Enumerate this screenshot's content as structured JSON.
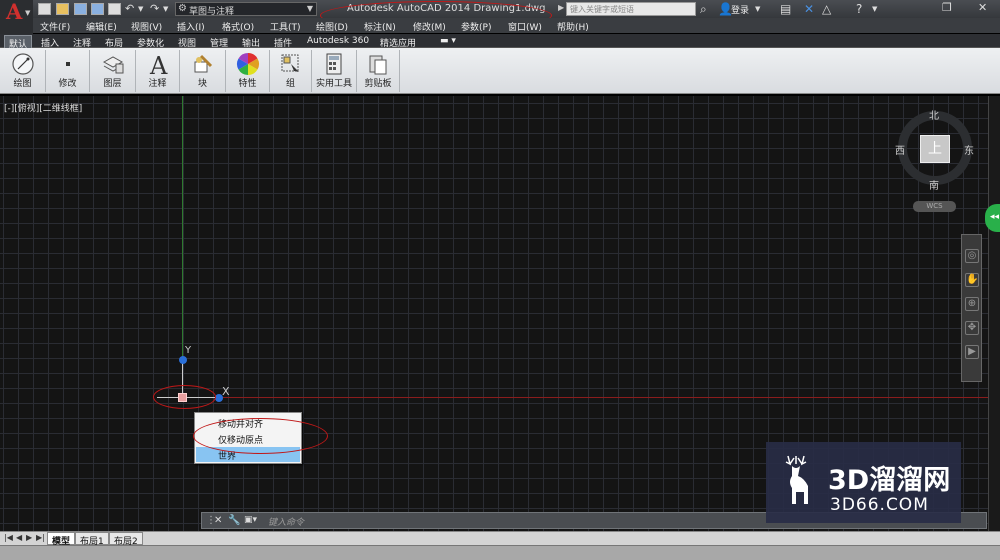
{
  "titlebar": {
    "app_logo": "A",
    "workspace": "草图与注释",
    "title": "Autodesk AutoCAD 2014    Drawing1.dwg",
    "search_placeholder": "键入关键字或短语",
    "login": "登录"
  },
  "menubar": [
    "文件(F)",
    "编辑(E)",
    "视图(V)",
    "插入(I)",
    "格式(O)",
    "工具(T)",
    "绘图(D)",
    "标注(N)",
    "修改(M)",
    "参数(P)",
    "窗口(W)",
    "帮助(H)"
  ],
  "ribbon_tabs": [
    "默认",
    "插入",
    "注释",
    "布局",
    "参数化",
    "视图",
    "管理",
    "输出",
    "插件",
    "Autodesk 360",
    "精选应用"
  ],
  "ribbon_panels": [
    "绘图",
    "修改",
    "图层",
    "注释",
    "块",
    "特性",
    "组",
    "实用工具",
    "剪贴板"
  ],
  "viewport": {
    "label": "[-][俯视][二维线框]",
    "ucs_x": "X",
    "ucs_y": "Y"
  },
  "context_menu": {
    "items": [
      "移动并对齐",
      "仅移动原点",
      "世界"
    ],
    "highlighted": "世界"
  },
  "viewcube": {
    "north": "北",
    "south": "南",
    "east": "东",
    "west": "西",
    "face": "上",
    "wcs": "WCS"
  },
  "command_line": {
    "placeholder": "键入命令"
  },
  "layout_tabs": [
    "模型",
    "布局1",
    "布局2"
  ],
  "watermark": {
    "brand": "3D溜溜网",
    "url": "3D66.COM"
  },
  "colors": {
    "annotation_red": "#c01818",
    "context_highlight": "#88c4f2",
    "y_axis": "#2f7a2f",
    "x_axis": "#8a1c1c"
  }
}
